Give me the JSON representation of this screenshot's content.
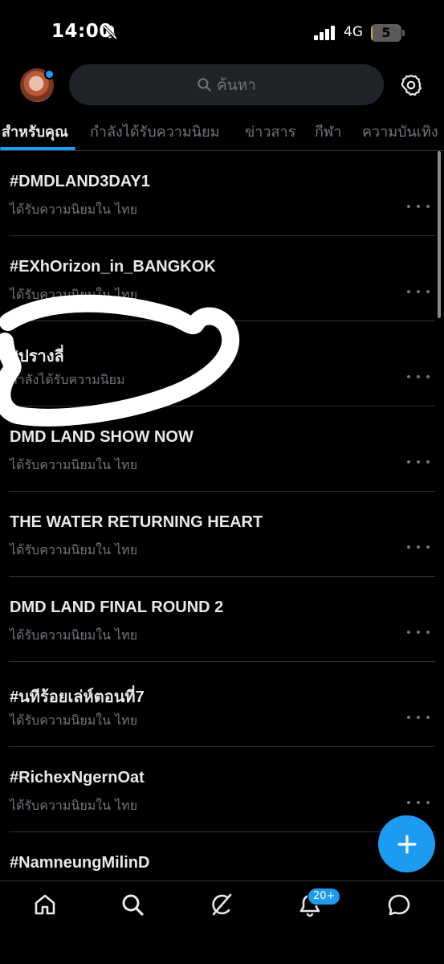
{
  "status_bar": {
    "time": "14:00",
    "network": "4G",
    "battery_level": "5",
    "battery_fraction": 0.05,
    "icons": [
      "bell-slash-icon",
      "signal-icon",
      "battery-icon"
    ]
  },
  "header": {
    "search_placeholder": "ค้นหา",
    "icons": [
      "avatar",
      "search-icon",
      "settings-gear-icon"
    ]
  },
  "tabs": [
    {
      "label": "สำหรับคุณ",
      "active": true
    },
    {
      "label": "กำลังได้รับความนิยม",
      "active": false
    },
    {
      "label": "ข่าวสาร",
      "active": false
    },
    {
      "label": "กีฬา",
      "active": false
    },
    {
      "label": "ความบันเทิง",
      "active": false
    }
  ],
  "trends": [
    {
      "title": "#DMDLAND3DAY1",
      "subtitle": "ได้รับความนิยมใน ไทย"
    },
    {
      "title": "#EXhOrizon_in_BANGKOK",
      "subtitle": "ได้รับความนิยมใน ไทย"
    },
    {
      "title": "#ปรางลี่",
      "subtitle": "กำลังได้รับความนิยม"
    },
    {
      "title": "DMD LAND SHOW NOW",
      "subtitle": "ได้รับความนิยมใน ไทย"
    },
    {
      "title": "THE WATER RETURNING HEART",
      "subtitle": "ได้รับความนิยมใน ไทย"
    },
    {
      "title": "DMD LAND FINAL ROUND 2",
      "subtitle": "ได้รับความนิยมใน ไทย"
    },
    {
      "title": "#นทีร้อยเล่ห์ตอนที่7",
      "subtitle": "ได้รับความนิยมใน ไทย"
    },
    {
      "title": "#RichexNgernOat",
      "subtitle": "ได้รับความนิยมใน ไทย"
    },
    {
      "title": "#NamneungMilinD",
      "subtitle": ""
    }
  ],
  "bottom_nav": {
    "items": [
      "home-icon",
      "search-icon",
      "grok-icon",
      "notifications-bell-icon",
      "messages-icon"
    ],
    "notification_badge": "20+"
  },
  "colors": {
    "background": "#000000",
    "accent": "#1d9bf0",
    "text_primary": "#e7e9ea",
    "text_secondary": "#71767b",
    "divider": "#2f3336",
    "annotation": "#ffffff"
  }
}
